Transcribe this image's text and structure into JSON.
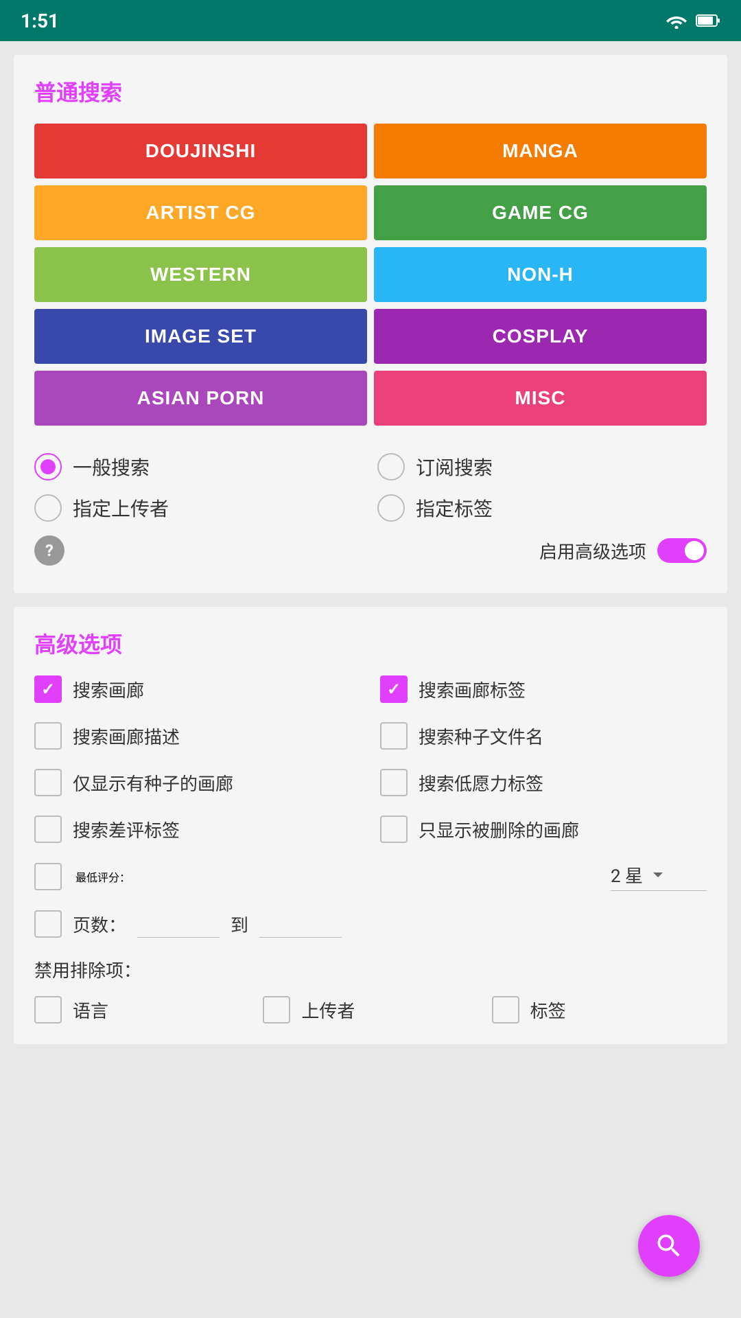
{
  "statusBar": {
    "time": "1:51"
  },
  "normalSearch": {
    "title": "普通搜索",
    "categories": [
      {
        "id": "doujinshi",
        "label": "DOUJINSHI",
        "class": "cat-doujinshi"
      },
      {
        "id": "manga",
        "label": "MANGA",
        "class": "cat-manga"
      },
      {
        "id": "artistcg",
        "label": "ARTIST CG",
        "class": "cat-artistcg"
      },
      {
        "id": "gamecg",
        "label": "GAME CG",
        "class": "cat-gamecg"
      },
      {
        "id": "western",
        "label": "WESTERN",
        "class": "cat-western"
      },
      {
        "id": "nonh",
        "label": "NON-H",
        "class": "cat-nonh"
      },
      {
        "id": "imageset",
        "label": "IMAGE SET",
        "class": "cat-imageset"
      },
      {
        "id": "cosplay",
        "label": "COSPLAY",
        "class": "cat-cosplay"
      },
      {
        "id": "asianporn",
        "label": "ASIAN PORN",
        "class": "cat-asianporn"
      },
      {
        "id": "misc",
        "label": "MISC",
        "class": "cat-misc"
      }
    ],
    "radioOptions": [
      {
        "id": "general",
        "label": "一般搜索",
        "selected": true
      },
      {
        "id": "subscription",
        "label": "订阅搜索",
        "selected": false
      },
      {
        "id": "uploader",
        "label": "指定上传者",
        "selected": false
      },
      {
        "id": "tag",
        "label": "指定标签",
        "selected": false
      }
    ],
    "advancedToggle": {
      "label": "启用高级选项",
      "enabled": true
    }
  },
  "advancedOptions": {
    "title": "高级选项",
    "checkboxes": [
      {
        "id": "search-gallery",
        "label": "搜索画廊",
        "checked": true
      },
      {
        "id": "search-gallery-tags",
        "label": "搜索画廊标签",
        "checked": true
      },
      {
        "id": "search-gallery-desc",
        "label": "搜索画廊描述",
        "checked": false
      },
      {
        "id": "search-torrent",
        "label": "搜索种子文件名",
        "checked": false
      },
      {
        "id": "only-with-torrent",
        "label": "仅显示有种子的画廊",
        "checked": false
      },
      {
        "id": "search-low-power",
        "label": "搜索低愿力标签",
        "checked": false
      },
      {
        "id": "search-downvote",
        "label": "搜索差评标签",
        "checked": false
      },
      {
        "id": "only-deleted",
        "label": "只显示被删除的画廊",
        "checked": false
      }
    ],
    "minRating": {
      "label": "最低评分：",
      "value": "2 星"
    },
    "pages": {
      "label": "页数：",
      "separator": "到",
      "fromValue": "",
      "toValue": ""
    },
    "exclusionLabel": "禁用排除项：",
    "exclusionItems": [
      {
        "id": "exc-lang",
        "label": "语言",
        "checked": false
      },
      {
        "id": "exc-uploader",
        "label": "上传者",
        "checked": false
      },
      {
        "id": "exc-tag",
        "label": "标签",
        "checked": false
      }
    ]
  },
  "fab": {
    "label": "搜索"
  }
}
